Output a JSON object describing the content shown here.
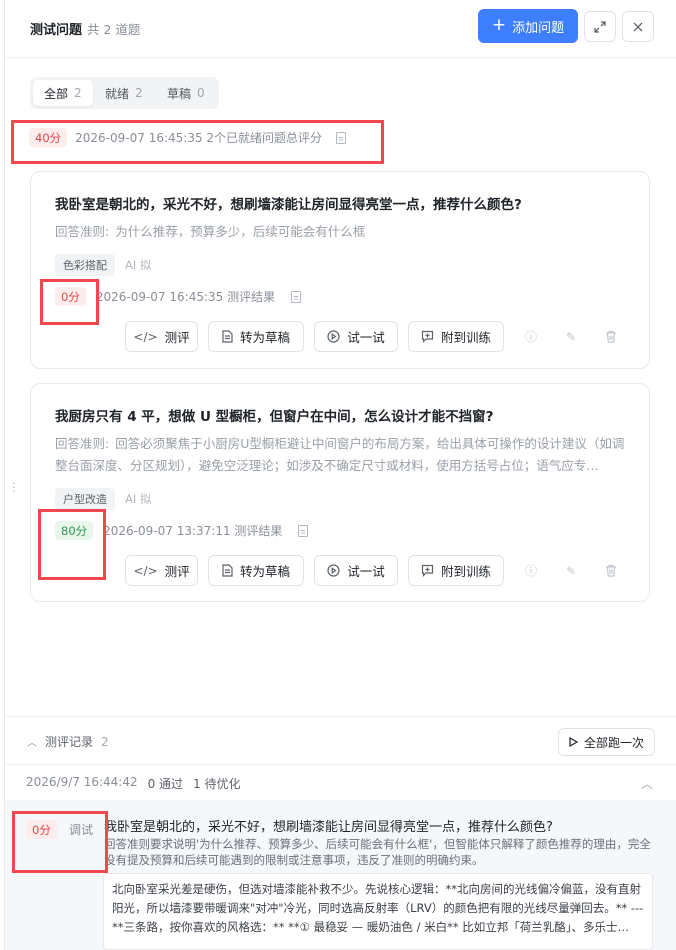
{
  "header": {
    "title": "测试问题",
    "count": "共 2 道题",
    "add_label": "添加问题",
    "expand_icon": "expand-icon",
    "close_icon": "close-icon"
  },
  "tabs": [
    {
      "label": "全部",
      "count": "2",
      "active": true
    },
    {
      "label": "就绪",
      "count": "2",
      "active": false
    },
    {
      "label": "草稿",
      "count": "0",
      "active": false
    }
  ],
  "summary": {
    "score": "40分",
    "text": "2026-09-07 16:45:35 2个已就绪问题总评分"
  },
  "questions": [
    {
      "title": "我卧室是朝北的，采光不好，想刷墙漆能让房间显得亮堂一点，推荐什么颜色?",
      "criteria_label": "回答准则:",
      "criteria": "为什么推荐，预算多少，后续可能会有什么框",
      "tag": "色彩搭配",
      "ai_tag": "AI 拟",
      "score": "0分",
      "score_level": "low",
      "result_text": "2026-09-07 16:45:35 测评结果"
    },
    {
      "title": "我厨房只有 4 平，想做 U 型橱柜，但窗户在中间，怎么设计才能不挡窗?",
      "criteria_label": "回答准则:",
      "criteria": "回答必须聚焦于小厨房U型橱柜避让中间窗户的布局方案，给出具体可操作的设计建议（如调整台面深度、分区规划），避免空泛理论；如涉及不确定尺寸或材料，使用方括号占位；语气应专…",
      "tag": "户型改造",
      "ai_tag": "AI 拟",
      "score": "80分",
      "score_level": "high",
      "result_text": "2026-09-07 13:37:11 测评结果"
    }
  ],
  "actions": {
    "evaluate": "测评",
    "to_draft": "转为草稿",
    "try": "试一试",
    "attach": "附到训练"
  },
  "records": {
    "label": "测评记录",
    "count": "2",
    "run_all": "全部跑一次",
    "row_time": "2026/9/7 16:44:42",
    "row_pass": "0 通过",
    "row_opt": "1 待优化"
  },
  "detail": {
    "score": "0分",
    "status": "调试",
    "question": "我卧室是朝北的，采光不好，想刷墙漆能让房间显得亮堂一点，推荐什么颜色?",
    "reason": "回答准则要求说明'为什么推荐、预算多少、后续可能会有什么框'，但智能体只解释了颜色推荐的理由，完全没有提及预算和后续可能遇到的限制或注意事项，违反了准则的明确约束。",
    "answer": "北向卧室采光差是硬伤，但选对墙漆能补救不少。先说核心逻辑：**北向房间的光线偏冷偏蓝，没有直射阳光，所以墙漆要带暖调来\"对冲\"冷光，同时选高反射率（LRV）的颜色把有限的光线尽量弹回去。** --- **三条路，按你喜欢的风格选：** **① 最稳妥 — 暖奶油色 / 米白** 比如立邦「荷兰乳酪」、多乐士…"
  },
  "colors": {
    "accent": "#3d7fff",
    "danger": "#e9474a",
    "success": "#2f9a52",
    "highlight_box": "#f0484e"
  }
}
